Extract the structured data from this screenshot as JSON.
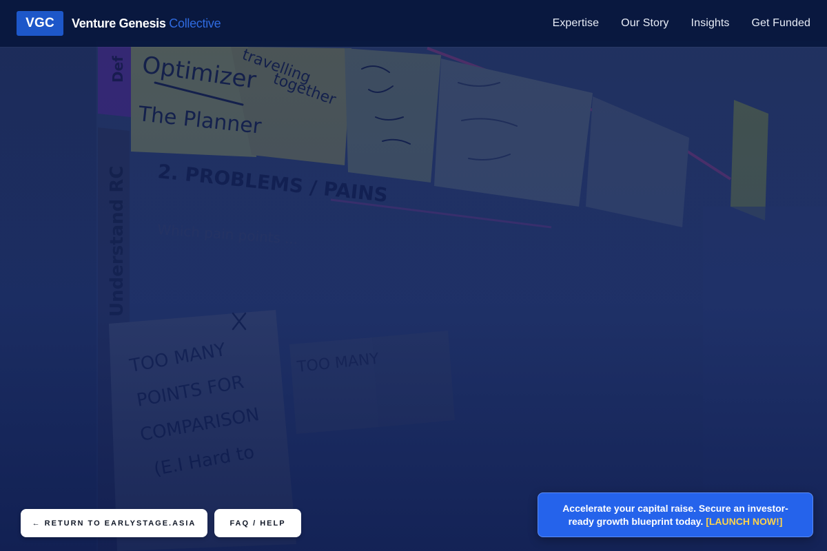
{
  "brand": {
    "badge": "VGC",
    "name": "Venture Genesis",
    "accent": "Collective"
  },
  "nav": {
    "items": [
      "Expertise",
      "Our Story",
      "Insights",
      "Get Funded"
    ]
  },
  "hero_image": {
    "whiteboard_text": [
      "Optimizer",
      "The Planner",
      "travelling together",
      "Def",
      "2. PROBLEMS / PAINS",
      "Understand RC",
      "Which pain points ...",
      "TOO MANY POINTS FOR COMPARISON",
      "Hard to",
      "TOO MANY",
      "X"
    ]
  },
  "footer_buttons": {
    "return_label": "← RETURN TO EARLYSTAGE.ASIA",
    "faq_label": "FAQ / HELP"
  },
  "cta": {
    "text": "Accelerate your capital raise. Secure an investor-ready growth blueprint today.",
    "link": "[LAUNCH NOW!]"
  },
  "colors": {
    "header_bg": "#08183e",
    "brand_badge": "#1d57c9",
    "brand_accent": "#2f6be0",
    "cta_bg": "#2563eb",
    "cta_link": "#fcd34d"
  }
}
